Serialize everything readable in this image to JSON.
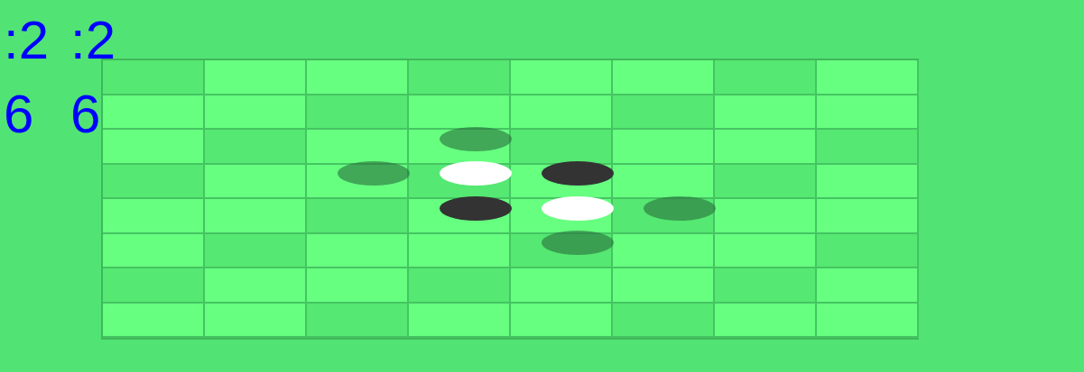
{
  "scores": [
    {
      "label": ":2",
      "value": "6"
    },
    {
      "label": ":2",
      "value": "6"
    }
  ],
  "board": {
    "rows": [
      [
        "empty",
        "empty",
        "empty",
        "empty",
        "empty",
        "empty",
        "empty",
        "empty"
      ],
      [
        "empty",
        "empty",
        "empty",
        "empty",
        "empty",
        "empty",
        "empty",
        "empty"
      ],
      [
        "empty",
        "empty",
        "empty",
        "hint",
        "empty",
        "empty",
        "empty",
        "empty"
      ],
      [
        "empty",
        "empty",
        "hint",
        "white",
        "black",
        "empty",
        "empty",
        "empty"
      ],
      [
        "empty",
        "empty",
        "empty",
        "black",
        "white",
        "hint",
        "empty",
        "empty"
      ],
      [
        "empty",
        "empty",
        "empty",
        "empty",
        "hint",
        "empty",
        "empty",
        "empty"
      ],
      [
        "empty",
        "empty",
        "empty",
        "empty",
        "empty",
        "empty",
        "empty",
        "empty"
      ],
      [
        "empty",
        "empty",
        "empty",
        "empty",
        "empty",
        "empty",
        "empty",
        "empty"
      ]
    ]
  }
}
